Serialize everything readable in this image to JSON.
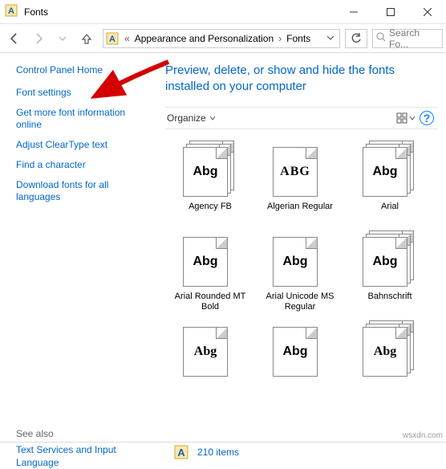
{
  "window": {
    "title": "Fonts"
  },
  "breadcrumb": {
    "seg1": "Appearance and Personalization",
    "seg2": "Fonts"
  },
  "search": {
    "placeholder": "Search Fo..."
  },
  "sidebar": {
    "home": "Control Panel Home",
    "items": [
      "Font settings",
      "Get more font information online",
      "Adjust ClearType text",
      "Find a character",
      "Download fonts for all languages"
    ],
    "see_also_label": "See also",
    "see_also": "Text Services and Input Language"
  },
  "headline": "Preview, delete, or show and hide the fonts installed on your computer",
  "toolbar": {
    "organize": "Organize"
  },
  "fonts": [
    {
      "name": "Agency FB",
      "sample": "Abg",
      "style": "font-family:'Agency FB',Arial Narrow,sans-serif; font-stretch:condensed;",
      "stack": true
    },
    {
      "name": "Algerian Regular",
      "sample": "ABG",
      "style": "font-family:Algerian,serif; letter-spacing:1px;",
      "stack": false
    },
    {
      "name": "Arial",
      "sample": "Abg",
      "style": "font-family:Arial,sans-serif;",
      "stack": true
    },
    {
      "name": "Arial Rounded MT Bold",
      "sample": "Abg",
      "style": "font-family:'Arial Rounded MT Bold',Arial,sans-serif; font-weight:900;",
      "stack": false
    },
    {
      "name": "Arial Unicode MS Regular",
      "sample": "Abg",
      "style": "font-family:'Arial Unicode MS',Arial,sans-serif;",
      "stack": false
    },
    {
      "name": "Bahnschrift",
      "sample": "Abg",
      "style": "font-family:Bahnschrift,Arial,sans-serif;",
      "stack": true
    },
    {
      "name": "",
      "sample": "Abg",
      "style": "font-family:'Baskerville Old Face',serif;",
      "stack": false
    },
    {
      "name": "",
      "sample": "Abg",
      "style": "font-family:'Bauhaus 93',Impact,sans-serif; font-weight:900;",
      "stack": false
    },
    {
      "name": "",
      "sample": "Abg",
      "style": "font-family:'Bell MT',serif;",
      "stack": true
    }
  ],
  "status": {
    "count": "210 items"
  },
  "watermark": "wsxdn.com"
}
